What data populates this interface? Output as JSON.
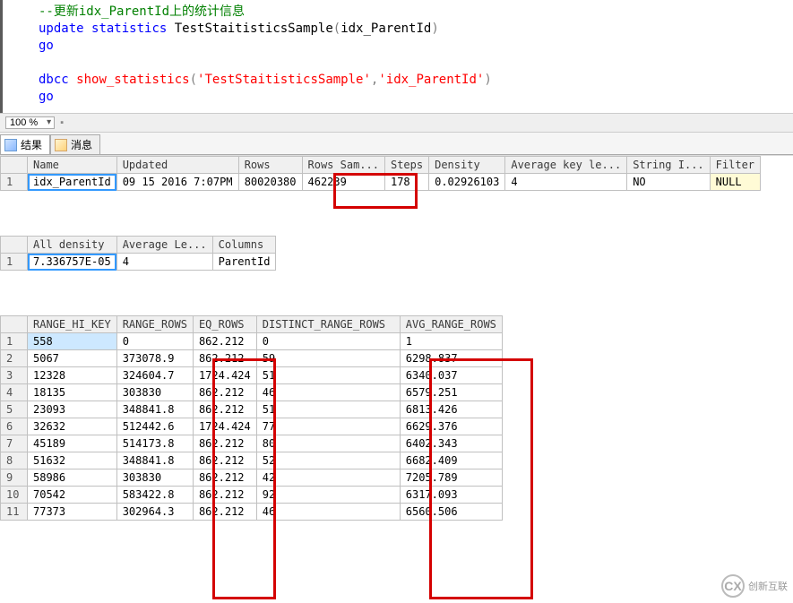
{
  "code": {
    "comment": "--更新idx_ParentId上的统计信息",
    "kw_update": "update",
    "kw_statistics": "statistics",
    "obj_name": " TestStaitisticsSample",
    "paren_open": "(",
    "arg": "idx_ParentId",
    "paren_close": ")",
    "go1": "go",
    "kw_dbcc": "dbcc",
    "fn": "show_statistics",
    "paren_open2": "(",
    "str1": "'TestStaitisticsSample'",
    "comma": ",",
    "str2": "'idx_ParentId'",
    "paren_close2": ")",
    "go2": "go"
  },
  "zoom": {
    "value": "100 %"
  },
  "tabs": {
    "results": "结果",
    "messages": "消息"
  },
  "grid1": {
    "headers": [
      "Name",
      "Updated",
      "Rows",
      "Rows Sam...",
      "Steps",
      "Density",
      "Average key le...",
      "String I...",
      "Filter"
    ],
    "rownum": "1",
    "cells": [
      "idx_ParentId",
      "09 15 2016  7:07PM",
      "80020380",
      "462239",
      "178",
      "0.02926103",
      "4",
      "NO",
      "NULL"
    ]
  },
  "grid2": {
    "headers": [
      "All density",
      "Average Le...",
      "Columns"
    ],
    "rownum": "1",
    "cells": [
      "7.336757E-05",
      "4",
      "ParentId"
    ]
  },
  "grid3": {
    "headers": [
      "RANGE_HI_KEY",
      "RANGE_ROWS",
      "EQ_ROWS",
      "DISTINCT_RANGE_ROWS",
      "AVG_RANGE_ROWS"
    ],
    "rows": [
      {
        "n": "1",
        "v": [
          "558",
          "0",
          "862.212",
          "0",
          "1"
        ]
      },
      {
        "n": "2",
        "v": [
          "5067",
          "373078.9",
          "862.212",
          "59",
          "6298.837"
        ]
      },
      {
        "n": "3",
        "v": [
          "12328",
          "324604.7",
          "1724.424",
          "51",
          "6340.037"
        ]
      },
      {
        "n": "4",
        "v": [
          "18135",
          "303830",
          "862.212",
          "46",
          "6579.251"
        ]
      },
      {
        "n": "5",
        "v": [
          "23093",
          "348841.8",
          "862.212",
          "51",
          "6813.426"
        ]
      },
      {
        "n": "6",
        "v": [
          "32632",
          "512442.6",
          "1724.424",
          "77",
          "6629.376"
        ]
      },
      {
        "n": "7",
        "v": [
          "45189",
          "514173.8",
          "862.212",
          "80",
          "6402.343"
        ]
      },
      {
        "n": "8",
        "v": [
          "51632",
          "348841.8",
          "862.212",
          "52",
          "6682.409"
        ]
      },
      {
        "n": "9",
        "v": [
          "58986",
          "303830",
          "862.212",
          "42",
          "7205.789"
        ]
      },
      {
        "n": "10",
        "v": [
          "70542",
          "583422.8",
          "862.212",
          "92",
          "6317.093"
        ]
      },
      {
        "n": "11",
        "v": [
          "77373",
          "302964.3",
          "862.212",
          "46",
          "6560.506"
        ]
      }
    ]
  },
  "logo_text": "创新互联"
}
